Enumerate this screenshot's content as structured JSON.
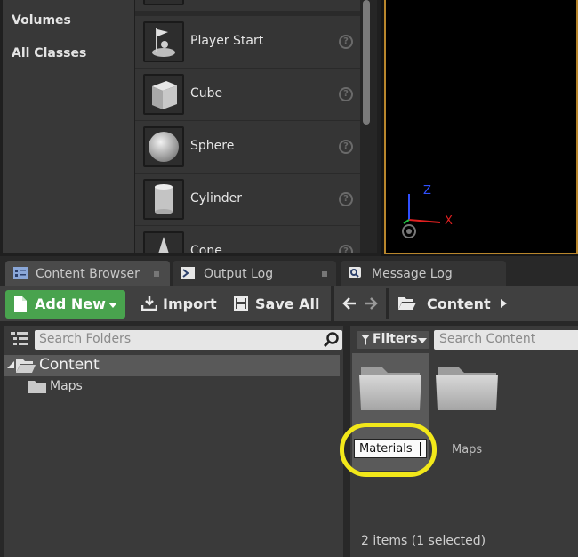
{
  "place_actors": {
    "categories": [
      "Volumes",
      "All Classes"
    ],
    "actors": [
      {
        "label": "Player Start",
        "icon": "player-start-icon"
      },
      {
        "label": "Cube",
        "icon": "cube-icon"
      },
      {
        "label": "Sphere",
        "icon": "sphere-icon"
      },
      {
        "label": "Cylinder",
        "icon": "cylinder-icon"
      },
      {
        "label": "Cone",
        "icon": "cone-icon"
      }
    ],
    "help_glyph": "?"
  },
  "viewport": {
    "axis_z": "Z",
    "axis_x": "X",
    "axis_colors": {
      "x": "#e02020",
      "y": "#20c040",
      "z": "#3050ff"
    }
  },
  "tabs": [
    {
      "label": "Content Browser",
      "icon": "content-browser-icon",
      "active": true
    },
    {
      "label": "Output Log",
      "icon": "output-log-icon",
      "active": false
    },
    {
      "label": "Message Log",
      "icon": "message-log-icon",
      "active": false
    }
  ],
  "toolbar": {
    "add_new_label": "Add New",
    "import_label": "Import",
    "save_all_label": "Save All",
    "breadcrumb_root": "Content",
    "add_new_color": "#49a34e"
  },
  "folders": {
    "search_placeholder": "Search Folders",
    "tree": [
      {
        "label": "Content",
        "expanded": true,
        "selected": true
      },
      {
        "label": "Maps",
        "expanded": false,
        "selected": false
      }
    ]
  },
  "assets": {
    "filters_label": "Filters",
    "search_placeholder": "Search Content",
    "items": [
      {
        "name": "Materials",
        "type": "folder",
        "selected": true,
        "renaming": true
      },
      {
        "name": "Maps",
        "type": "folder",
        "selected": false,
        "renaming": false
      }
    ],
    "status": "2 items (1 selected)"
  },
  "annotation": {
    "highlight_color": "#f2e81a"
  }
}
